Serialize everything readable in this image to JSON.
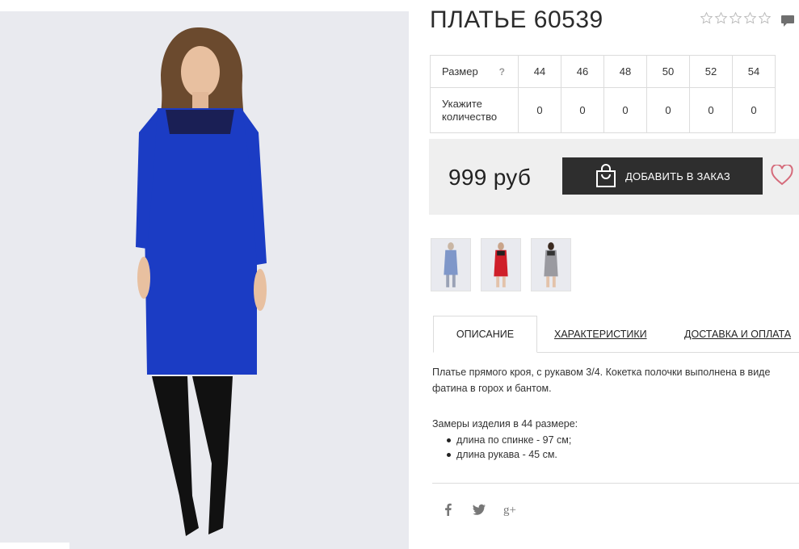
{
  "product": {
    "title": "ПЛАТЬЕ 60539",
    "rating": 0,
    "rating_max": 5
  },
  "sizes_table": {
    "size_label": "Размер",
    "help": "?",
    "qty_label": "Укажите количество",
    "sizes": [
      "44",
      "46",
      "48",
      "50",
      "52",
      "54"
    ],
    "quantities": [
      "0",
      "0",
      "0",
      "0",
      "0",
      "0"
    ]
  },
  "purchase": {
    "price": "999 руб",
    "add_button": "ДОБАВИТЬ В ЗАКАЗ"
  },
  "thumbnails": [
    {
      "color": "#7f97c9",
      "name": "blue-dress"
    },
    {
      "color": "#cf1f2a",
      "name": "red-dress"
    },
    {
      "color": "#9a9aa0",
      "name": "grey-dress"
    }
  ],
  "tabs": [
    "ОПИСАНИЕ",
    "ХАРАКТЕРИСТИКИ",
    "ДОСТАВКА И ОПЛАТА"
  ],
  "description": {
    "text": "Платье прямого кроя, с рукавом 3/4. Кокетка полочки выполнена в виде фатина в горох и бантом.",
    "measures_title": "Замеры изделия в 44 размере:",
    "measures": [
      "длина по спинке - 97 см;",
      "длина рукава - 45 см."
    ]
  },
  "social": {
    "icons": [
      "facebook-icon",
      "twitter-icon",
      "google-plus-icon"
    ],
    "gplus_glyph": "g+"
  },
  "colors": {
    "dress_blue": "#1b3cc4",
    "button_dark": "#2e2e2e",
    "price_bg": "#efefef",
    "heart": "#d56a7a"
  }
}
